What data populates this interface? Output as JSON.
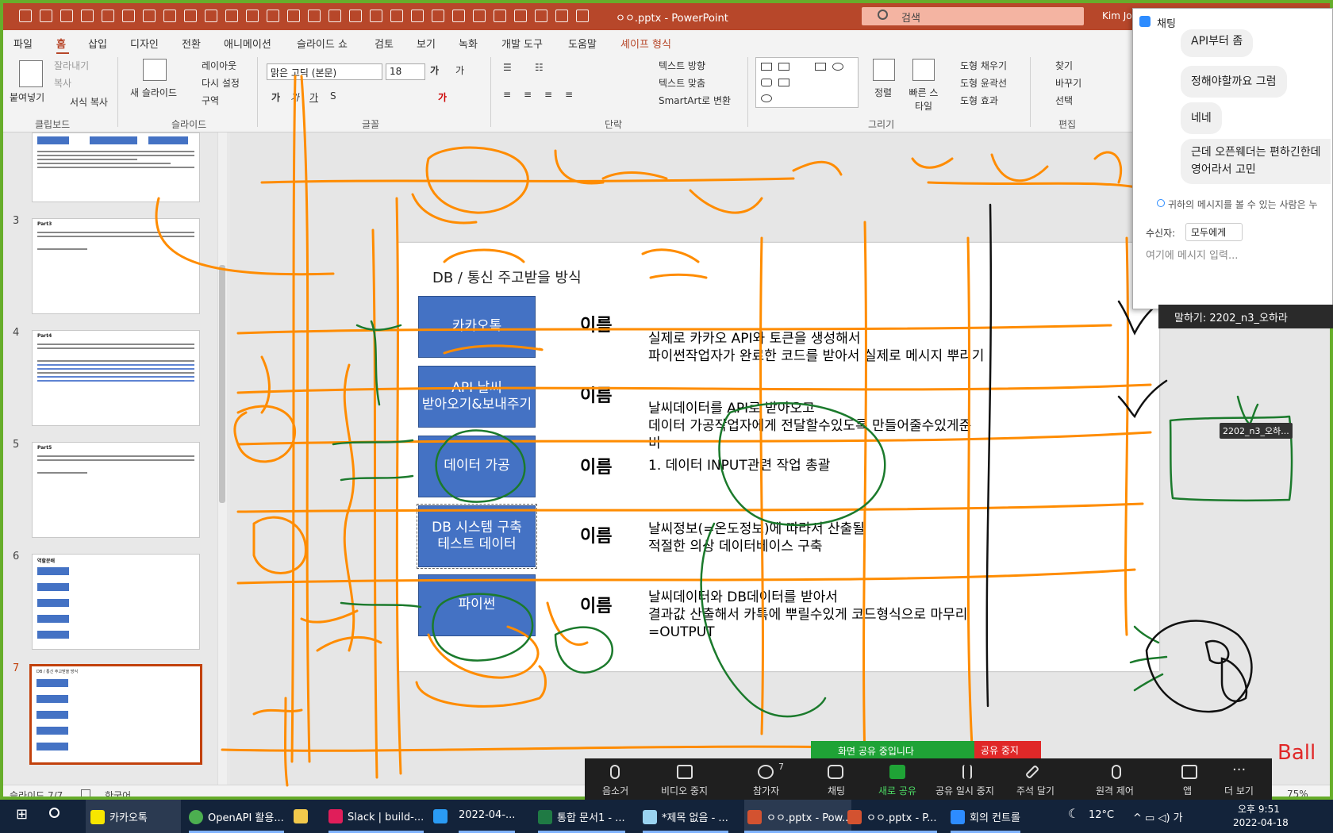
{
  "window": {
    "title": "ㅇㅇ.pptx - PowerPoint",
    "search_placeholder": "검색",
    "user": "Kim Jon"
  },
  "tabs": [
    "파일",
    "홈",
    "삽입",
    "디자인",
    "전환",
    "애니메이션",
    "슬라이드 쇼",
    "검토",
    "보기",
    "녹화",
    "개발 도구",
    "도움말",
    "셰이프 형식"
  ],
  "ribbon": {
    "paste": "붙여넣기",
    "cut": "잘라내기",
    "copy": "복사",
    "format_painter": "서식 복사",
    "group_clipboard": "클립보드",
    "new_slide": "새 슬라이드",
    "layout": "레이아웃",
    "reset": "다시 설정",
    "section": "구역",
    "group_slide": "슬라이드",
    "font_name": "맑은 고딕 (본문)",
    "font_size": "18",
    "group_font": "글꼴",
    "text_direction": "텍스트 방향",
    "text_align": "텍스트 맞춤",
    "smartart": "SmartArt로 변환",
    "group_paragraph": "단락",
    "arrange": "정렬",
    "quick_styles": "빠른 스타일",
    "shape_fill": "도형 채우기",
    "shape_outline": "도형 윤곽선",
    "shape_effects": "도형 효과",
    "group_drawing": "그리기",
    "find": "찾기",
    "replace": "바꾸기",
    "select": "선택",
    "group_editing": "편집"
  },
  "thumbnails": [
    {
      "num": "3",
      "title": "Part3"
    },
    {
      "num": "4",
      "title": "Part4"
    },
    {
      "num": "5",
      "title": "Part5"
    },
    {
      "num": "6",
      "title": "역할분배"
    },
    {
      "num": "7",
      "title": "DB / 통신 주고받을 방식"
    }
  ],
  "slide": {
    "title": "DB / 통신 주고받을 방식",
    "rows": [
      {
        "box": "카카오톡",
        "name": "이름",
        "desc": [
          "실제로 카카오 API와 토큰을 생성해서",
          "파이썬작업자가 완료한 코드를 받아서 실제로 메시지 뿌리기"
        ]
      },
      {
        "box": "API 날씨\n받아오기&보내주기",
        "name": "이름",
        "desc": [
          "날씨데이터를 API로 받아오고",
          "데이터 가공작업자에게 전달할수있도록 만들어줄수있게준",
          "비"
        ]
      },
      {
        "box": "데이터 가공",
        "name": "이름",
        "desc": [
          "1.   데이터 INPUT관련 작업 총괄"
        ]
      },
      {
        "box": "DB 시스템 구축\n테스트 데이터",
        "name": "이름",
        "desc": [
          "날씨정보(=온도정보)에 따라서 산출될",
          "적절한 의상 데이터베이스 구축"
        ]
      },
      {
        "box": "파이썬",
        "name": "이름",
        "desc": [
          "날씨데이터와 DB데이터를 받아서",
          "결과값 산출해서 카톡에 뿌릴수있게 코드형식으로 마무리",
          "=OUTPUT"
        ]
      }
    ]
  },
  "status": {
    "slide": "슬라이드 7/7",
    "lang": "한국어",
    "zoom": "75%"
  },
  "chat": {
    "title": "채팅",
    "messages": [
      "API부터 좀",
      "정해야할까요 그럼",
      "네네",
      "근데 오픈웨더는 편하긴한데",
      "영어라서 고민"
    ],
    "notice": "귀하의 메시지를 볼 수 있는 사람은 누",
    "recipient_label": "수신자:",
    "recipient": "모두에게",
    "input_placeholder": "여기에 메시지 입력..."
  },
  "speaker_strip": "말하기: 2202_n3_오하라",
  "annotator_tag": "2202_n3_오하...",
  "share": {
    "sharing": "화면 공유 중입니다",
    "stop": "공유 중지"
  },
  "zoom_controls": [
    {
      "label": "음소거",
      "icon": "microphone-icon"
    },
    {
      "label": "비디오 중지",
      "icon": "video-camera-icon"
    },
    {
      "label": "참가자",
      "icon": "participants-icon",
      "badge": "7"
    },
    {
      "label": "채팅",
      "icon": "chat-bubble-icon"
    },
    {
      "label": "새로 공유",
      "icon": "share-up-icon"
    },
    {
      "label": "공유 일시 중지",
      "icon": "pause-icon"
    },
    {
      "label": "주석 달기",
      "icon": "pencil-icon"
    },
    {
      "label": "원격 제어",
      "icon": "mouse-icon"
    },
    {
      "label": "앱",
      "icon": "apps-icon"
    },
    {
      "label": "더 보기",
      "icon": "more-icon"
    }
  ],
  "taskbar": {
    "items": [
      "카카오톡",
      "OpenAPI 활용...",
      "Slack | build-...",
      "2022-04-...",
      "통합 문서1 - ...",
      "*제목 없음 - ...",
      "ㅇㅇ.pptx - Pow...",
      "ㅇㅇ.pptx - P...",
      "회의 컨트롤"
    ],
    "temp": "12°C",
    "time": "오후 9:51",
    "date": "2022-04-18"
  },
  "colors": {
    "accent": "#b7472a",
    "box_fill": "#4472c4",
    "ink_orange": "#ff8c00",
    "ink_green": "#1b7a2c",
    "ink_black": "#111111"
  }
}
